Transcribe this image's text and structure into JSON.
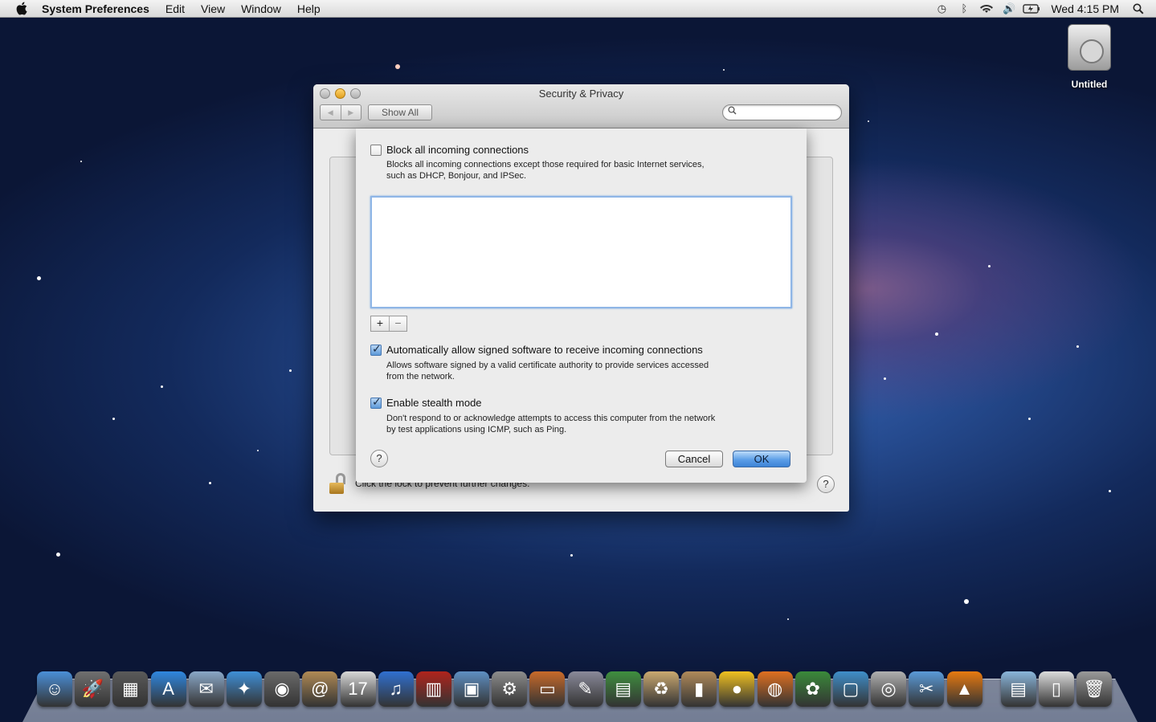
{
  "menubar": {
    "app_name": "System Preferences",
    "items": [
      "Edit",
      "View",
      "Window",
      "Help"
    ],
    "clock": "Wed 4:15 PM"
  },
  "desktop": {
    "disk_label": "Untitled"
  },
  "window": {
    "title": "Security & Privacy",
    "show_all": "Show All",
    "search_placeholder": "",
    "lock_text": "Click the lock to prevent further changes.",
    "help": "?"
  },
  "sheet": {
    "block_all": {
      "label": "Block all incoming connections",
      "checked": false,
      "desc_line1": "Blocks all incoming connections except those required for basic Internet services,",
      "desc_line2": "such as DHCP, Bonjour, and IPSec."
    },
    "add_button": "+",
    "remove_button": "−",
    "auto_allow": {
      "label": "Automatically allow signed software to receive incoming connections",
      "checked": true,
      "desc_line1": "Allows software signed by a valid certificate authority to provide services accessed",
      "desc_line2": "from the network."
    },
    "stealth": {
      "label": "Enable stealth mode",
      "checked": true,
      "desc_line1": "Don't respond to or acknowledge attempts to access this computer from the network",
      "desc_line2": "by test applications using ICMP, such as Ping."
    },
    "help": "?",
    "cancel": "Cancel",
    "ok": "OK"
  },
  "dock": {
    "icons": [
      {
        "name": "finder-icon",
        "color": "#4a8fd8",
        "glyph": "☺"
      },
      {
        "name": "launchpad-icon",
        "color": "#707070",
        "glyph": "🚀"
      },
      {
        "name": "mission-control-icon",
        "color": "#5a5a5a",
        "glyph": "▦"
      },
      {
        "name": "app-store-icon",
        "color": "#2f87e0",
        "glyph": "A"
      },
      {
        "name": "preview-icon",
        "color": "#8aa7c7",
        "glyph": "✉"
      },
      {
        "name": "safari-icon",
        "color": "#3f8fd6",
        "glyph": "✦"
      },
      {
        "name": "facetime-icon",
        "color": "#6a6a6a",
        "glyph": "◉"
      },
      {
        "name": "address-book-icon",
        "color": "#b08a55",
        "glyph": "@"
      },
      {
        "name": "ical-icon",
        "color": "#d8d8d8",
        "glyph": "17"
      },
      {
        "name": "itunes-icon",
        "color": "#3070d0",
        "glyph": "♫"
      },
      {
        "name": "photo-booth-icon",
        "color": "#b0241c",
        "glyph": "▥"
      },
      {
        "name": "iphoto-icon",
        "color": "#5f8fc2",
        "glyph": "▣"
      },
      {
        "name": "system-preferences-icon",
        "color": "#8c8c8c",
        "glyph": "⚙"
      },
      {
        "name": "keynote-icon",
        "color": "#c86a2a",
        "glyph": "▭"
      },
      {
        "name": "script-editor-icon",
        "color": "#8a8a9a",
        "glyph": "✎"
      },
      {
        "name": "numbers-icon",
        "color": "#3f8f3f",
        "glyph": "▤"
      },
      {
        "name": "recycle-icon",
        "color": "#caa870",
        "glyph": "♻"
      },
      {
        "name": "archive-icon",
        "color": "#b08a5a",
        "glyph": "▮"
      },
      {
        "name": "cyberduck-icon",
        "color": "#f0c020",
        "glyph": "●"
      },
      {
        "name": "firefox-icon",
        "color": "#e07020",
        "glyph": "◍"
      },
      {
        "name": "adium-icon",
        "color": "#3a8a3a",
        "glyph": "✿"
      },
      {
        "name": "remote-desktop-icon",
        "color": "#3f8ec9",
        "glyph": "▢"
      },
      {
        "name": "disk-utility-icon",
        "color": "#b0b0b0",
        "glyph": "◎"
      },
      {
        "name": "automator-icon",
        "color": "#5a9ad8",
        "glyph": "✂"
      },
      {
        "name": "vlc-icon",
        "color": "#e87a10",
        "glyph": "▲"
      },
      {
        "name": "downloads-folder-icon",
        "color": "#8ab5da",
        "glyph": "▤"
      },
      {
        "name": "documents-stack-icon",
        "color": "#dcdcdc",
        "glyph": "▯"
      },
      {
        "name": "trash-icon",
        "color": "#9a9a9a",
        "glyph": "🗑"
      }
    ]
  }
}
